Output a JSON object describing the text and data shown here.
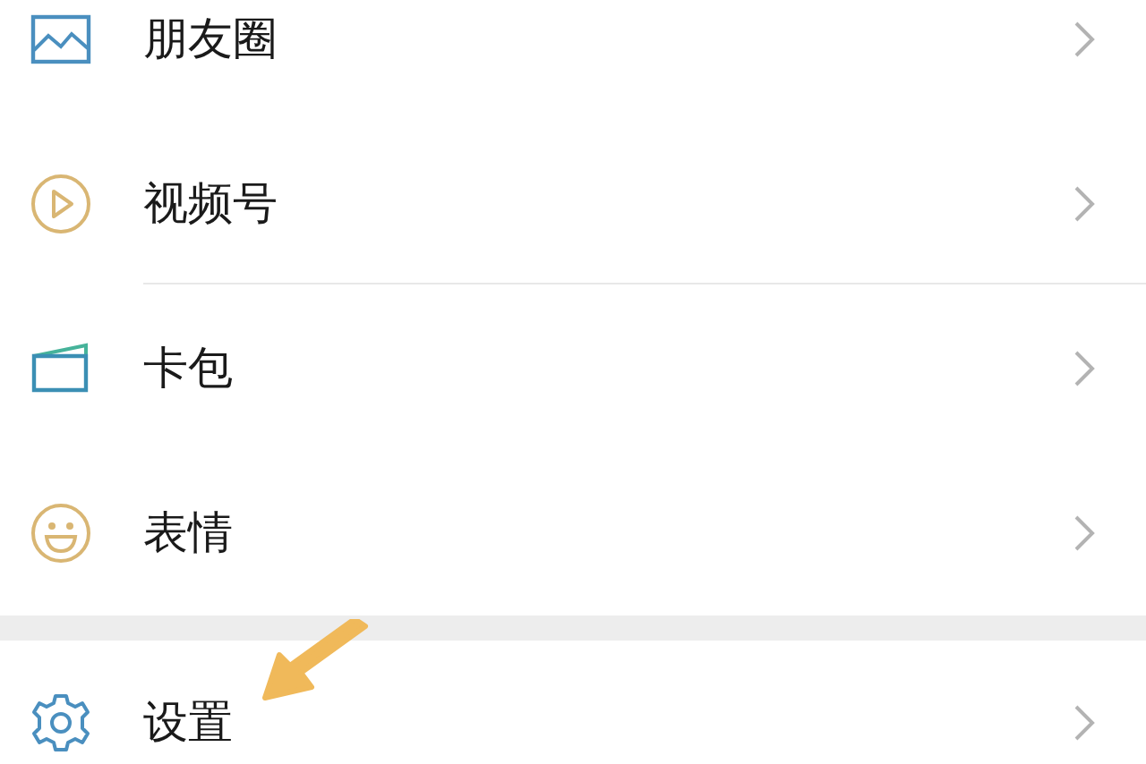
{
  "sections": [
    {
      "items": [
        {
          "label": "朋友圈",
          "separator": false
        },
        {
          "label": "视频号",
          "separator": true
        },
        {
          "label": "卡包",
          "separator": false
        },
        {
          "label": "表情",
          "separator": false
        }
      ]
    },
    {
      "items": [
        {
          "label": "设置",
          "separator": false
        }
      ]
    }
  ]
}
